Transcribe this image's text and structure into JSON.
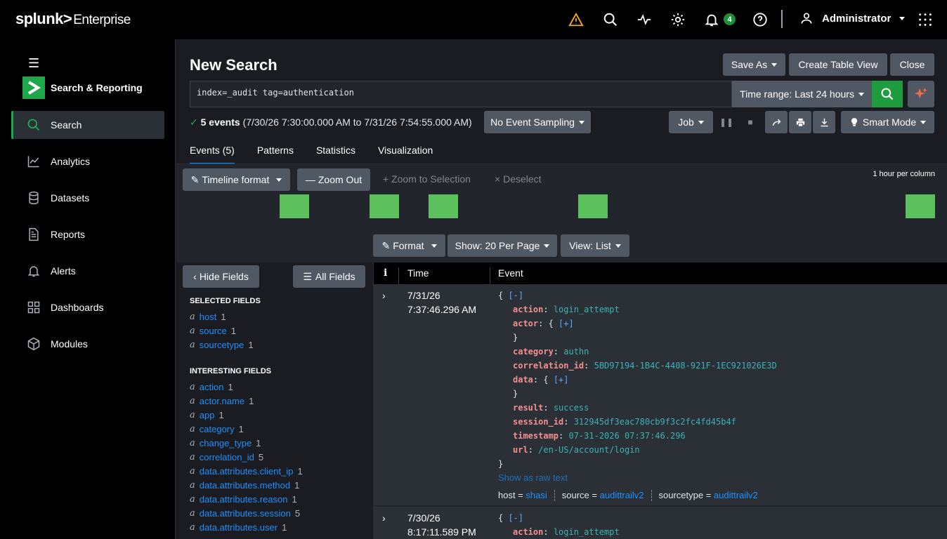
{
  "topbar": {
    "logo": "splunk>",
    "product": "Enterprise",
    "notifications_count": "4",
    "user": "Administrator"
  },
  "sidebar": {
    "app_name": "Search & Reporting",
    "items": [
      {
        "label": "Search",
        "icon": "search-icon"
      },
      {
        "label": "Analytics",
        "icon": "chart-icon"
      },
      {
        "label": "Datasets",
        "icon": "database-icon"
      },
      {
        "label": "Reports",
        "icon": "document-icon"
      },
      {
        "label": "Alerts",
        "icon": "bell-icon"
      },
      {
        "label": "Dashboards",
        "icon": "dashboard-icon"
      },
      {
        "label": "Modules",
        "icon": "cube-icon"
      }
    ]
  },
  "header": {
    "title": "New Search",
    "save_as": "Save As",
    "create_table": "Create Table View",
    "close": "Close"
  },
  "search": {
    "query": "index=_audit tag=authentication",
    "time_range": "Time range: Last 24 hours"
  },
  "status": {
    "count": "5 events",
    "range": "(7/30/26 7:30:00.000 AM to 7/31/26 7:54:55.000 AM)",
    "sampling": "No Event Sampling",
    "job": "Job",
    "mode": "Smart Mode"
  },
  "tabs": [
    "Events (5)",
    "Patterns",
    "Statistics",
    "Visualization"
  ],
  "timeline": {
    "format": "Timeline format",
    "zoom_out": "Zoom Out",
    "zoom_sel": "Zoom to Selection",
    "deselect": "Deselect",
    "scale": "1 hour per column",
    "bar_color": "#5cc05c"
  },
  "format_row": {
    "format": "Format",
    "show": "Show: 20 Per Page",
    "view": "View: List"
  },
  "fields": {
    "hide": "Hide Fields",
    "all": "All Fields",
    "selected_title": "SELECTED FIELDS",
    "selected": [
      {
        "name": "host",
        "count": "1"
      },
      {
        "name": "source",
        "count": "1"
      },
      {
        "name": "sourcetype",
        "count": "1"
      }
    ],
    "interesting_title": "INTERESTING FIELDS",
    "interesting": [
      {
        "name": "action",
        "count": "1"
      },
      {
        "name": "actor.name",
        "count": "1"
      },
      {
        "name": "app",
        "count": "1"
      },
      {
        "name": "category",
        "count": "1"
      },
      {
        "name": "change_type",
        "count": "1"
      },
      {
        "name": "correlation_id",
        "count": "5"
      },
      {
        "name": "data.attributes.client_ip",
        "count": "1"
      },
      {
        "name": "data.attributes.method",
        "count": "1"
      },
      {
        "name": "data.attributes.reason",
        "count": "1"
      },
      {
        "name": "data.attributes.session",
        "count": "5"
      },
      {
        "name": "data.attributes.user",
        "count": "1"
      }
    ]
  },
  "results": {
    "col_i": "i",
    "col_time": "Time",
    "col_event": "Event",
    "events": [
      {
        "date": "7/31/26",
        "time": "7:37:46.296 AM",
        "action": "login_attempt",
        "category": "authn",
        "correlation_id": "5BD97194-1B4C-4408-921F-1EC921026E3D",
        "result": "success",
        "session_id": "312945df3eac780cb9f3c2fc4fd45b4f",
        "timestamp": "07-31-2026 07:37:46.296",
        "url": "/en-US/account/login",
        "raw_link": "Show as raw text",
        "host": "shasi",
        "source": "audittrailv2",
        "sourcetype": "audittrailv2"
      },
      {
        "date": "7/30/26",
        "time": "8:17:11.589 PM",
        "action": "login_attempt"
      }
    ]
  }
}
